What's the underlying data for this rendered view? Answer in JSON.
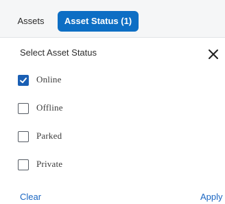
{
  "tabs": {
    "assets_label": "Assets",
    "status_label": "Asset Status (1)"
  },
  "panel": {
    "title": "Select Asset Status",
    "close_icon": "close-icon",
    "options": [
      {
        "label": "Online",
        "checked": true
      },
      {
        "label": "Offline",
        "checked": false
      },
      {
        "label": "Parked",
        "checked": false
      },
      {
        "label": "Private",
        "checked": false
      }
    ],
    "clear_label": "Clear",
    "apply_label": "Apply"
  },
  "colors": {
    "accent": "#0d6ec4",
    "checkbox_checked": "#1a5fb4",
    "link": "#1a66c2"
  }
}
